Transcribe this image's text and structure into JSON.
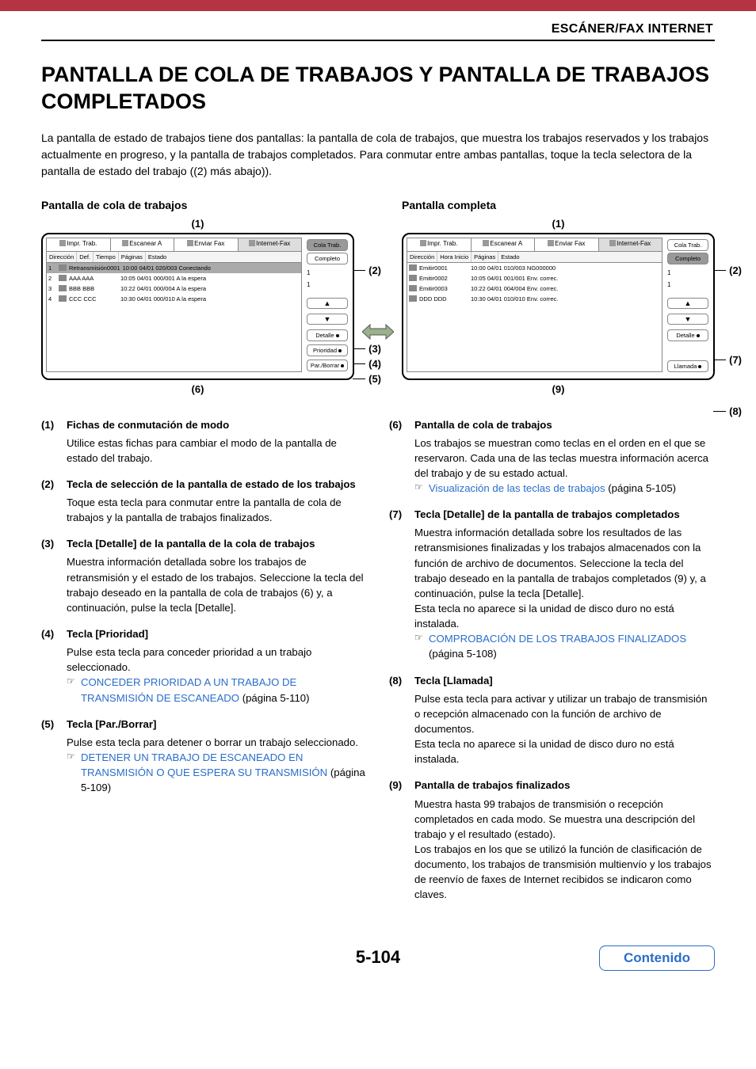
{
  "header": {
    "section_label": "ESCÁNER/FAX INTERNET"
  },
  "title": "PANTALLA DE COLA DE TRABAJOS Y PANTALLA DE TRABAJOS COMPLETADOS",
  "intro": "La pantalla de estado de trabajos tiene dos pantallas: la pantalla de cola de trabajos, que muestra los trabajos reservados y los trabajos actualmente en progreso, y la pantalla de trabajos completados. Para conmutar entre ambas pantallas, toque la tecla selectora de la pantalla de estado del trabajo ((2) más abajo)).",
  "panel_left": {
    "caption": "Pantalla de cola de trabajos",
    "callout_top": "(1)",
    "callout_bottom": "(6)",
    "callouts_right": [
      "(2)",
      "(3)",
      "(4)",
      "(5)"
    ],
    "tabs": [
      "Impr. Trab.",
      "Escanear A",
      "Enviar Fax",
      "Internet-Fax"
    ],
    "cols": [
      "Dirección",
      "Def.",
      "Tiempo",
      "Páginas",
      "Estado"
    ],
    "rows": [
      {
        "n": "1",
        "addr": "Retransmisión0001",
        "det": "10:00 04/01 020/003 Conectando",
        "sel": true
      },
      {
        "n": "2",
        "addr": "AAA AAA",
        "det": "10:05 04/01 000/001 A la espera",
        "sel": false
      },
      {
        "n": "3",
        "addr": "BBB BBB",
        "det": "10:22 04/01 000/004 A la espera",
        "sel": false
      },
      {
        "n": "4",
        "addr": "CCC CCC",
        "det": "10:30 04/01 000/010 A la espera",
        "sel": false
      }
    ],
    "side_main": [
      {
        "label": "Cola Trab.",
        "sel": true
      },
      {
        "label": "Completo",
        "sel": false
      }
    ],
    "side_marks": [
      "1",
      "1"
    ],
    "side_actions": [
      "Detalle",
      "Prioridad",
      "Par./Borrar"
    ]
  },
  "panel_right": {
    "caption": "Pantalla completa",
    "callout_top": "(1)",
    "callout_bottom": "(9)",
    "callouts_right": [
      "(2)",
      "(7)",
      "(8)"
    ],
    "tabs": [
      "Impr. Trab.",
      "Escanear A",
      "Enviar Fax",
      "Internet-Fax"
    ],
    "cols": [
      "Dirección",
      "Hora Inicio",
      "Páginas",
      "Estado"
    ],
    "rows": [
      {
        "n": "",
        "addr": "Emitir0001",
        "det": "10:00 04/01 010/003 NG000000",
        "sel": false
      },
      {
        "n": "",
        "addr": "Emitir0002",
        "det": "10:05 04/01 001/001 Env. correc.",
        "sel": false
      },
      {
        "n": "",
        "addr": "Emitir0003",
        "det": "10:22 04/01 004/004 Env. correc.",
        "sel": false
      },
      {
        "n": "",
        "addr": "DDD DDD",
        "det": "10:30 04/01 010/010 Env. correc.",
        "sel": false
      }
    ],
    "side_main": [
      {
        "label": "Cola Trab.",
        "sel": false
      },
      {
        "label": "Completo",
        "sel": true
      }
    ],
    "side_marks": [
      "1",
      "1"
    ],
    "side_actions": [
      "Detalle",
      "Llamada"
    ]
  },
  "desc_left": [
    {
      "n": "(1)",
      "head": "Fichas de conmutación de modo",
      "body": "Utilice estas fichas para cambiar el modo de la pantalla de estado del trabajo."
    },
    {
      "n": "(2)",
      "head": "Tecla de selección de la pantalla de estado de los trabajos",
      "body": "Toque esta tecla para conmutar entre la pantalla de cola de trabajos y la pantalla de trabajos finalizados."
    },
    {
      "n": "(3)",
      "head": "Tecla [Detalle] de la pantalla de la cola de trabajos",
      "body": "Muestra información detallada sobre los trabajos de retransmisión y el estado de los trabajos. Seleccione la tecla del trabajo deseado en la pantalla de cola de trabajos (6) y, a continuación, pulse la tecla [Detalle]."
    },
    {
      "n": "(4)",
      "head": "Tecla [Prioridad]",
      "body": "Pulse esta tecla para conceder prioridad a un trabajo seleccionado.",
      "link": {
        "text": "CONCEDER PRIORIDAD A UN TRABAJO DE TRANSMISIÓN DE ESCANEADO",
        "after": " (página 5-110)"
      }
    },
    {
      "n": "(5)",
      "head": "Tecla [Par./Borrar]",
      "body": "Pulse esta tecla para detener o borrar un trabajo seleccionado.",
      "link": {
        "text": "DETENER UN TRABAJO DE ESCANEADO EN TRANSMISIÓN O QUE ESPERA SU TRANSMISIÓN",
        "after": " (página 5-109)"
      }
    }
  ],
  "desc_right": [
    {
      "n": "(6)",
      "head": "Pantalla de cola de trabajos",
      "body": "Los trabajos se muestran como teclas en el orden en el que se reservaron. Cada una de las teclas muestra información acerca del trabajo y de su estado actual.",
      "link": {
        "text": "Visualización de las teclas de trabajos",
        "after": " (página 5-105)"
      }
    },
    {
      "n": "(7)",
      "head": "Tecla [Detalle] de la pantalla de trabajos completados",
      "body": "Muestra información detallada sobre los resultados de las retransmisiones finalizadas y los trabajos almacenados con la función de archivo de documentos. Seleccione la tecla del trabajo deseado en la pantalla de trabajos completados (9) y, a continuación, pulse la tecla [Detalle].\nEsta tecla no aparece si la unidad de disco duro no está instalada.",
      "link": {
        "text": "COMPROBACIÓN DE LOS TRABAJOS FINALIZADOS",
        "after": " (página 5-108)"
      }
    },
    {
      "n": "(8)",
      "head": "Tecla [Llamada]",
      "body": "Pulse esta tecla para activar y utilizar un trabajo de transmisión o recepción almacenado con la función de archivo de documentos.\nEsta tecla no aparece si la unidad de disco duro no está instalada."
    },
    {
      "n": "(9)",
      "head": "Pantalla de trabajos finalizados",
      "body": "Muestra hasta 99 trabajos de transmisión o recepción completados en cada modo. Se muestra una descripción del trabajo y el resultado (estado).\nLos trabajos en los que se utilizó la función de clasificación de documento, los trabajos de transmisión multienvío y los trabajos de reenvío de faxes de Internet recibidos se indicaron como claves."
    }
  ],
  "footer": {
    "page_number": "5-104",
    "contents_label": "Contenido"
  }
}
